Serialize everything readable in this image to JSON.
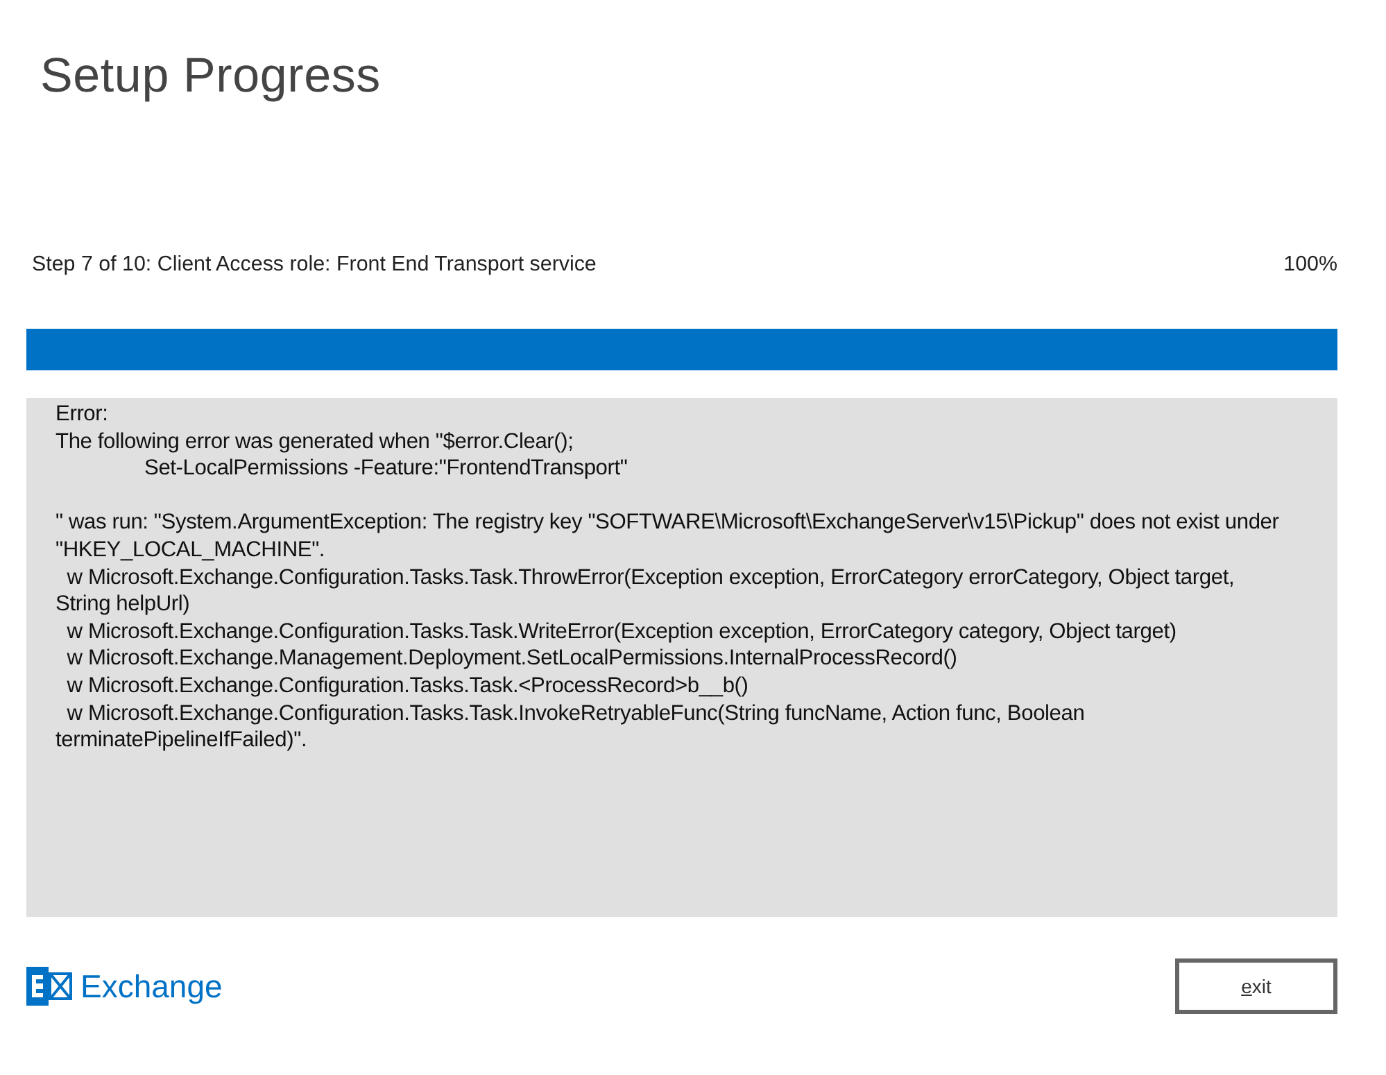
{
  "title": "Setup Progress",
  "step": {
    "label": "Step 7 of 10: Client Access role: Front End Transport service",
    "percent": "100%",
    "level": 1
  },
  "error_text": "Error:\nThe following error was generated when \"$error.Clear();\n\t\tSet-LocalPermissions -Feature:\"FrontendTransport\"\n\n\" was run: \"System.ArgumentException: The registry key \"SOFTWARE\\Microsoft\\ExchangeServer\\v15\\Pickup\" does not exist under\n\"HKEY_LOCAL_MACHINE\".\n  w Microsoft.Exchange.Configuration.Tasks.Task.ThrowError(Exception exception, ErrorCategory errorCategory, Object target,\nString helpUrl)\n  w Microsoft.Exchange.Configuration.Tasks.Task.WriteError(Exception exception, ErrorCategory category, Object target)\n  w Microsoft.Exchange.Management.Deployment.SetLocalPermissions.InternalProcessRecord()\n  w Microsoft.Exchange.Configuration.Tasks.Task.<ProcessRecord>b__b()\n  w Microsoft.Exchange.Configuration.Tasks.Task.InvokeRetryableFunc(String funcName, Action func, Boolean\nterminatePipelineIfFailed)\".",
  "footer": {
    "brand": "Exchange",
    "button": "exit"
  }
}
